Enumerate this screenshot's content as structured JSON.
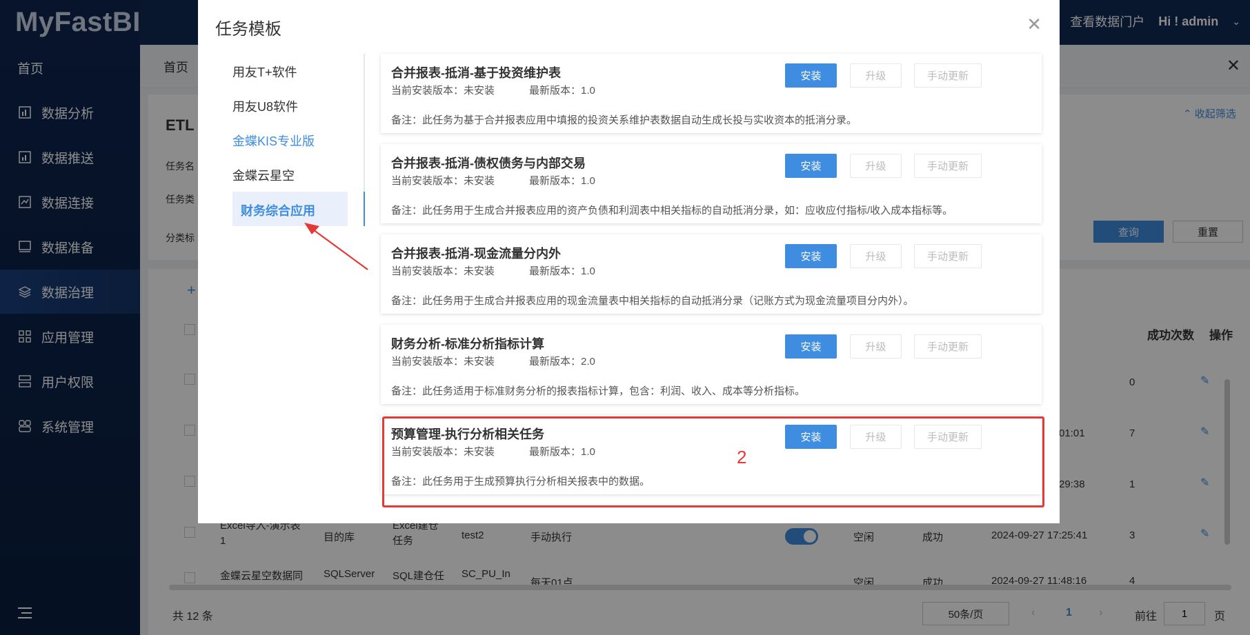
{
  "app": {
    "logo": "MyFastBI"
  },
  "topbar": {
    "portal": "查看数据门户",
    "user": "Hi ! admin"
  },
  "sidebar": {
    "items": [
      {
        "label": "首页"
      },
      {
        "label": "数据分析"
      },
      {
        "label": "数据推送"
      },
      {
        "label": "数据连接"
      },
      {
        "label": "数据准备"
      },
      {
        "label": "数据治理"
      },
      {
        "label": "应用管理"
      },
      {
        "label": "用户权限"
      },
      {
        "label": "系统管理"
      }
    ]
  },
  "tabs": {
    "home": "首页"
  },
  "filter": {
    "title": "ETL",
    "task_name": "任务名",
    "task_type": "任务类",
    "category": "分类标",
    "collapse": "收起筛选",
    "query": "查询",
    "reset": "重置"
  },
  "table": {
    "header_success": "成功次数",
    "header_ops": "操作",
    "rows": [
      {
        "c_time": "",
        "c_count": "0"
      },
      {
        "c_time": "01:01",
        "c_count": "7"
      },
      {
        "c_time": "29:38",
        "c_count": "1"
      },
      {
        "c_name": "Excel导入-演示表1",
        "c_target": "目的库",
        "c_type": "Excel建仓任务",
        "c_obj": "test2",
        "c_mode": "手动执行",
        "c_state": "空闲",
        "c_result": "成功",
        "c_time": "2024-09-27 17:25:41",
        "c_count": "3"
      },
      {
        "c_name": "金蝶云星空数据同",
        "c_target": "SQLServer",
        "c_type": "SQL建仓任",
        "c_obj": "SC_PU_In",
        "c_mode": "每天01点",
        "c_state": "空闲",
        "c_result": "成功",
        "c_time": "2024-09-27 11:48:16",
        "c_count": "4"
      }
    ]
  },
  "pagination": {
    "total": "共 12 条",
    "page_size": "50条/页",
    "current": "1",
    "goto_label": "前往",
    "goto_value": "1",
    "page_unit": "页"
  },
  "modal": {
    "title": "任务模板",
    "categories": [
      {
        "label": "用友T+软件"
      },
      {
        "label": "用友U8软件"
      },
      {
        "label": "金蝶KIS专业版"
      },
      {
        "label": "金蝶云星空"
      },
      {
        "label": "财务综合应用"
      }
    ],
    "buttons": {
      "install": "安装",
      "upgrade": "升级",
      "manual": "手动更新"
    },
    "templates": [
      {
        "name": "合并报表-抵消-基于投资维护表",
        "current": "当前安装版本：未安装",
        "latest": "最新版本：1.0",
        "note": "备注：此任务为基于合并报表应用中填报的投资关系维护表数据自动生成长投与实收资本的抵消分录。"
      },
      {
        "name": "合并报表-抵消-债权债务与内部交易",
        "current": "当前安装版本：未安装",
        "latest": "最新版本：1.0",
        "note": "备注：此任务用于生成合并报表应用的资产负债和利润表中相关指标的自动抵消分录，如：应收应付指标/收入成本指标等。"
      },
      {
        "name": "合并报表-抵消-现金流量分内外",
        "current": "当前安装版本：未安装",
        "latest": "最新版本：1.0",
        "note": "备注：此任务用于生成合并报表应用的现金流量表中相关指标的自动抵消分录（记账方式为现金流量项目分内外）。"
      },
      {
        "name": "财务分析-标准分析指标计算",
        "current": "当前安装版本：未安装",
        "latest": "最新版本：2.0",
        "note": "备注：此任务适用于标准财务分析的报表指标计算，包含：利润、收入、成本等分析指标。"
      },
      {
        "name": "预算管理-执行分析相关任务",
        "current": "当前安装版本：未安装",
        "latest": "最新版本：1.0",
        "note": "备注：此任务用于生成预算执行分析相关报表中的数据。"
      }
    ],
    "annotation": "2"
  }
}
